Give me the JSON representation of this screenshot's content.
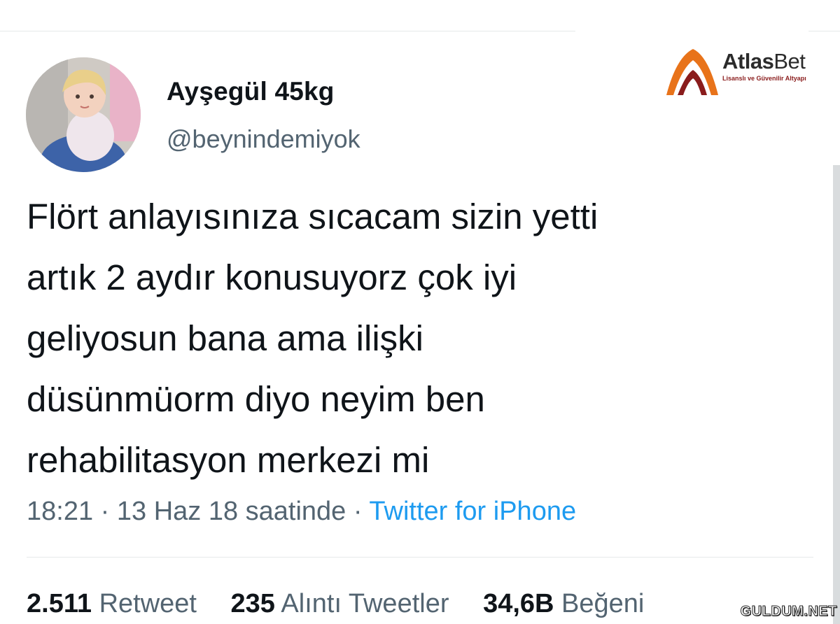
{
  "user": {
    "display_name": "Ayşegül 45kg",
    "handle": "@beynindemiyok"
  },
  "brand": {
    "name_bold": "Atlas",
    "name_light": "Bet",
    "tagline": "Lisanslı ve Güvenilir Altyapı"
  },
  "tweet": {
    "lines": [
      "Flört anlayısınıza sıcacam sizin yetti",
      "artık 2 aydır konusuyorz çok iyi",
      "geliyosun bana ama ilişki",
      "düsünmüorm diyo neyim ben",
      "rehabilitasyon merkezi mi"
    ],
    "time": "18:21 · 13 Haz 18 saatinde ·",
    "source": "Twitter for iPhone"
  },
  "stats": [
    {
      "count": "2.511",
      "label": "Retweet"
    },
    {
      "count": "235",
      "label": "Alıntı Tweetler"
    },
    {
      "count": "34,6B",
      "label": "Beğeni"
    }
  ],
  "watermark": "GULDUM.NET",
  "colors": {
    "text": "#0f1419",
    "muted": "#536471",
    "link": "#1d9bf0",
    "brand_orange": "#e8731a",
    "brand_red": "#8a1c1c"
  }
}
